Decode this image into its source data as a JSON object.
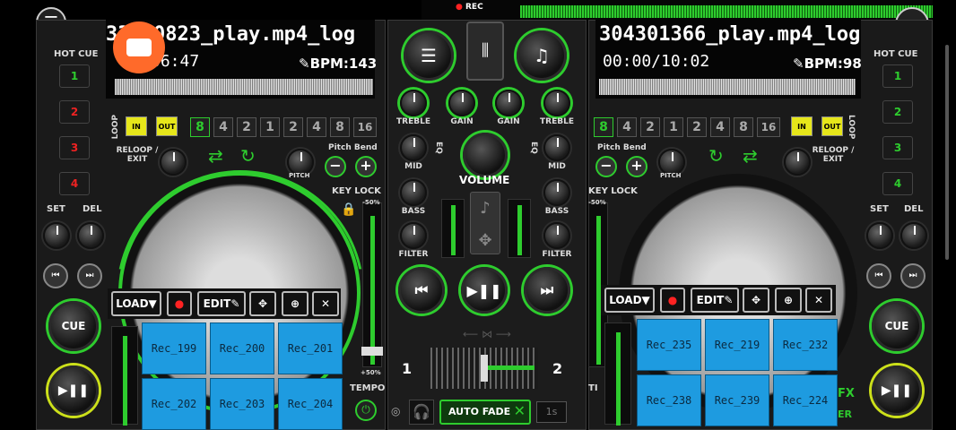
{
  "rec_label": "REC",
  "left": {
    "title": "33 10823_play.mp4_log",
    "time": "06:47",
    "bpm": "BPM:143",
    "hot_cue_label": "HOT CUE",
    "hot_cues": [
      "1",
      "2",
      "3",
      "4"
    ],
    "set_label": "SET",
    "del_label": "DEL",
    "loop_label": "LOOP",
    "in_label": "IN",
    "out_label": "OUT",
    "loop_values": [
      "8",
      "4",
      "2",
      "1",
      "2",
      "4",
      "8",
      "16"
    ],
    "reloop_label": "RELOOP / EXIT",
    "pitch_bend_label": "Pitch Bend",
    "pitch_label": "PITCH",
    "key_lock_label": "KEY LOCK",
    "tempo_label": "TEMPO",
    "pitch_pct_top": "-50%",
    "pitch_pct_bottom": "+50%",
    "load_label": "LOAD▼",
    "edit_label": "EDIT",
    "cue_label": "CUE",
    "pads": [
      "Rec_199",
      "Rec_200",
      "Rec_201",
      "Rec_202",
      "Rec_203",
      "Rec_204"
    ]
  },
  "right": {
    "title": "304301366_play.mp4_log",
    "time": "00:00/10:02",
    "bpm": "BPM:98",
    "hot_cue_label": "HOT CUE",
    "hot_cues": [
      "1",
      "2",
      "3",
      "4"
    ],
    "set_label": "SET",
    "del_label": "DEL",
    "loop_label": "LOOP",
    "in_label": "IN",
    "out_label": "OUT",
    "loop_values": [
      "8",
      "4",
      "2",
      "1",
      "2",
      "4",
      "8",
      "16"
    ],
    "reloop_label": "RELOOP / EXIT",
    "pitch_bend_label": "Pitch Bend",
    "pitch_label": "PITCH",
    "key_lock_label": "KEY LOCK",
    "pitch_pct_top": "-50%",
    "load_label": "LOAD▼",
    "edit_label": "EDIT",
    "cue_label": "CUE",
    "fx_label": "FX",
    "er_label": "ER",
    "ti_label": "TI",
    "pads": [
      "Rec_235",
      "Rec_219",
      "Rec_232",
      "Rec_238",
      "Rec_239",
      "Rec_224"
    ]
  },
  "mixer": {
    "treble": "TREBLE",
    "gain": "GAIN",
    "mid": "MID",
    "bass": "BASS",
    "filter": "FILTER",
    "eq": "EQ",
    "volume": "VOLUME",
    "cross_left": "1",
    "cross_right": "2",
    "auto_fade": "AUTO FADE",
    "fade_time": "1s"
  },
  "colors": {
    "accent": "#2ecc2e",
    "pad": "#1e9be0",
    "record": "#ff6a2a"
  }
}
